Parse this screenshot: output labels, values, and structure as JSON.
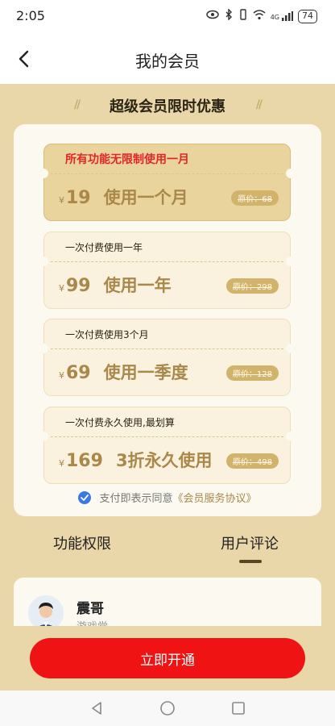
{
  "status": {
    "time": "2:05",
    "battery": "74",
    "signal_label": "4G"
  },
  "nav": {
    "title": "我的会员"
  },
  "banner": {
    "title": "超级会员限时优惠",
    "slashes": "//"
  },
  "plans": [
    {
      "subtitle": "所有功能无限制使用一月",
      "currency": "¥",
      "price": "19",
      "label": "使用一个月",
      "original": "原价：68",
      "selected": true
    },
    {
      "subtitle": "一次付费使用一年",
      "currency": "¥",
      "price": "99",
      "label": "使用一年",
      "original": "原价：298",
      "selected": false
    },
    {
      "subtitle": "一次付费使用3个月",
      "currency": "¥",
      "price": "69",
      "label": "使用一季度",
      "original": "原价：128",
      "selected": false
    },
    {
      "subtitle": "一次付费永久使用,最划算",
      "currency": "¥",
      "price": "169",
      "label": "3折永久使用",
      "original": "原价：498",
      "selected": false
    }
  ],
  "agreement": {
    "text": "支付即表示同意",
    "link": "《会员服务协议》",
    "checked": true
  },
  "tabs": [
    {
      "label": "功能权限",
      "active": false
    },
    {
      "label": "用户评论",
      "active": true
    }
  ],
  "review": {
    "name": "震哥",
    "subtitle": "游戏党"
  },
  "cta": {
    "label": "立即开通"
  },
  "colors": {
    "accent": "#f01313",
    "gold": "#a9884a",
    "background": "#e9d7a9",
    "check": "#3a78e7"
  }
}
